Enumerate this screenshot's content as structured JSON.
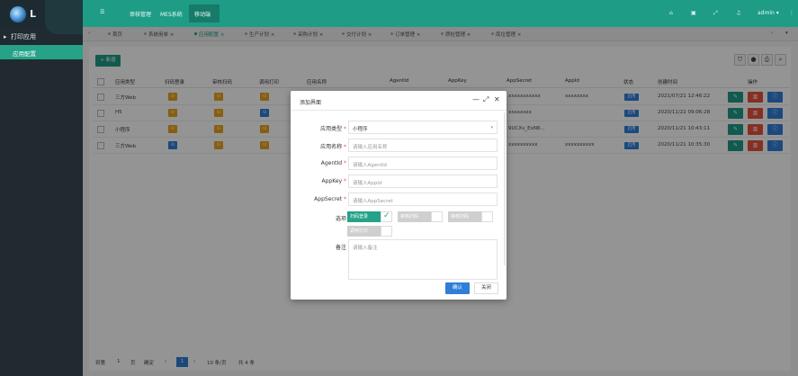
{
  "sidebar": {
    "logo_letter": "L",
    "menu_group": "打印应用",
    "menu_item": "应用配置"
  },
  "topbar": {
    "nav": [
      "审核管理",
      "MES系统",
      "移动端"
    ],
    "user": "admin",
    "icons": [
      "home-icon",
      "lock-icon",
      "expand-icon",
      "bell-icon",
      "user-caret-icon",
      "more-icon"
    ]
  },
  "tabs": [
    "首页",
    "系统用单",
    "应用配置",
    "生产计划",
    "采购计划",
    "交付计划",
    "订单管理",
    "质检管理",
    "库位管理"
  ],
  "toolbar": {
    "add_label": "+ 新增",
    "icons": [
      "filter-icon",
      "user-icon",
      "print-icon",
      "search-icon"
    ]
  },
  "table": {
    "headers": [
      "应用类型",
      "扫码登录",
      "审核扫码",
      "调用打印",
      "应用名称",
      "AgentId",
      "AppKey",
      "AppSecret",
      "AppId",
      "状态",
      "创建时间",
      "操作"
    ],
    "rows": [
      {
        "type": "三方Web",
        "c1": "orange",
        "c2": "orange",
        "c3": "orange",
        "appsecret": "xxxxxxxxxxx",
        "appid": "xxxxxxxx",
        "status": "启用",
        "created": "2021/07/21 12:46:22"
      },
      {
        "type": "H5",
        "c1": "orange",
        "c2": "orange",
        "c3": "blue",
        "appsecret": "xxxxxxxx",
        "appid": "",
        "status": "启用",
        "created": "2020/11/22 09:06:28"
      },
      {
        "type": "小程序",
        "c1": "orange",
        "c2": "orange",
        "c3": "orange",
        "appsecret": "9UCXv_ExN6...",
        "appid": "",
        "status": "启用",
        "created": "2020/11/21 10:43:11"
      },
      {
        "type": "三方Web",
        "c1": "blue",
        "c2": "orange",
        "c3": "orange",
        "appsecret": "xxxxxxxxxx",
        "appid": "xxxxxxxxxx",
        "status": "启用",
        "created": "2020/11/21 10:35:30"
      }
    ]
  },
  "pager": {
    "goto_label": "到第",
    "page_input": "1",
    "page_unit": "页",
    "confirm": "确定",
    "prev": "‹",
    "current": "1",
    "next": "›",
    "page_size": "10 条/页",
    "total": "共 4 条"
  },
  "modal": {
    "title": "添加界面",
    "fields": {
      "app_type": {
        "label": "应用类型",
        "value": "小程序"
      },
      "app_name": {
        "label": "应用名称",
        "placeholder": "请输入应用名称"
      },
      "agent_id": {
        "label": "AgentId",
        "placeholder": "请输入AgentId"
      },
      "app_key": {
        "label": "AppKey",
        "placeholder": "请输入AppId"
      },
      "app_secret": {
        "label": "AppSecret",
        "placeholder": "请输入AppSecret"
      }
    },
    "options_label": "选项",
    "options": [
      {
        "label": "扫码登录",
        "checked": true
      },
      {
        "label": "审核扫码",
        "checked": false
      },
      {
        "label": "审核扫码",
        "checked": false
      },
      {
        "label": "调用打印",
        "checked": false
      }
    ],
    "remark_label": "备注",
    "remark_placeholder": "请输入备注",
    "ok": "确认",
    "close": "关闭"
  },
  "colors": {
    "accent": "#1e9c86",
    "blue": "#2f7ed8",
    "orange": "#e8a21d",
    "danger": "#e5533d"
  }
}
